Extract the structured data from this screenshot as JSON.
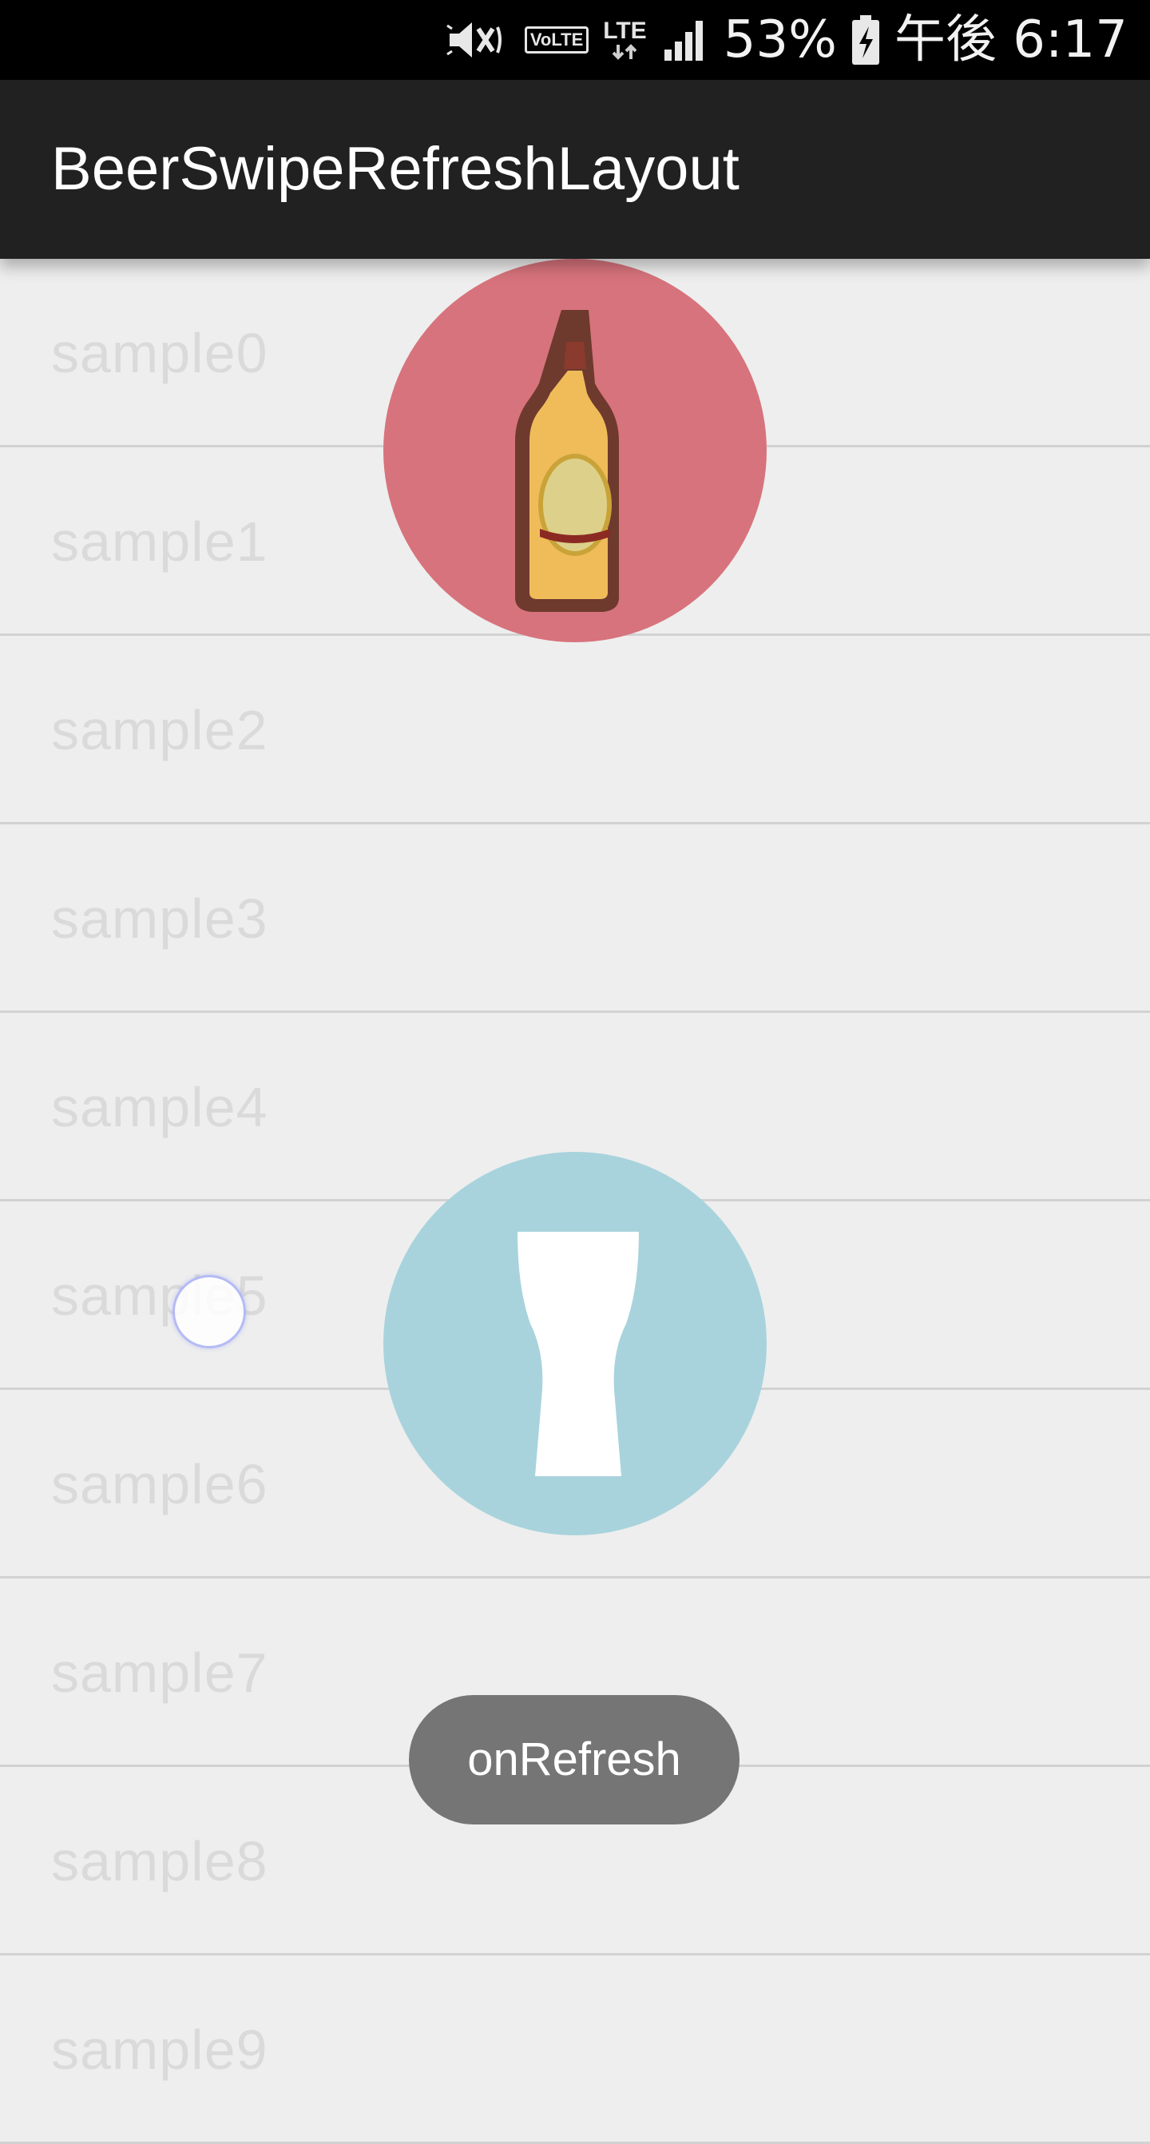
{
  "status_bar": {
    "icons": [
      "mute-icon",
      "volte-icon",
      "lte-icon",
      "signal-icon",
      "battery-charging-icon"
    ],
    "volte_label": "VoLTE",
    "lte_label": "LTE",
    "battery": "53%",
    "time": "午後 6:17"
  },
  "app_bar": {
    "title": "BeerSwipeRefreshLayout"
  },
  "list": {
    "items": [
      {
        "label": "sample0"
      },
      {
        "label": "sample1"
      },
      {
        "label": "sample2"
      },
      {
        "label": "sample3"
      },
      {
        "label": "sample4"
      },
      {
        "label": "sample5"
      },
      {
        "label": "sample6"
      },
      {
        "label": "sample7"
      },
      {
        "label": "sample8"
      },
      {
        "label": "sample9"
      }
    ]
  },
  "refresh": {
    "bottle_icon": "beer-bottle-icon",
    "glass_icon": "beer-glass-icon",
    "colors": {
      "bottle_circle": "#d7737c",
      "glass_circle": "#a8d3dc"
    }
  },
  "toast": {
    "message": "onRefresh"
  },
  "colors": {
    "status_bar": "#000000",
    "app_bar": "#212121",
    "background": "#eeeeee",
    "divider": "#d2d2d2",
    "list_text": "#dadada",
    "toast": "#757575"
  }
}
